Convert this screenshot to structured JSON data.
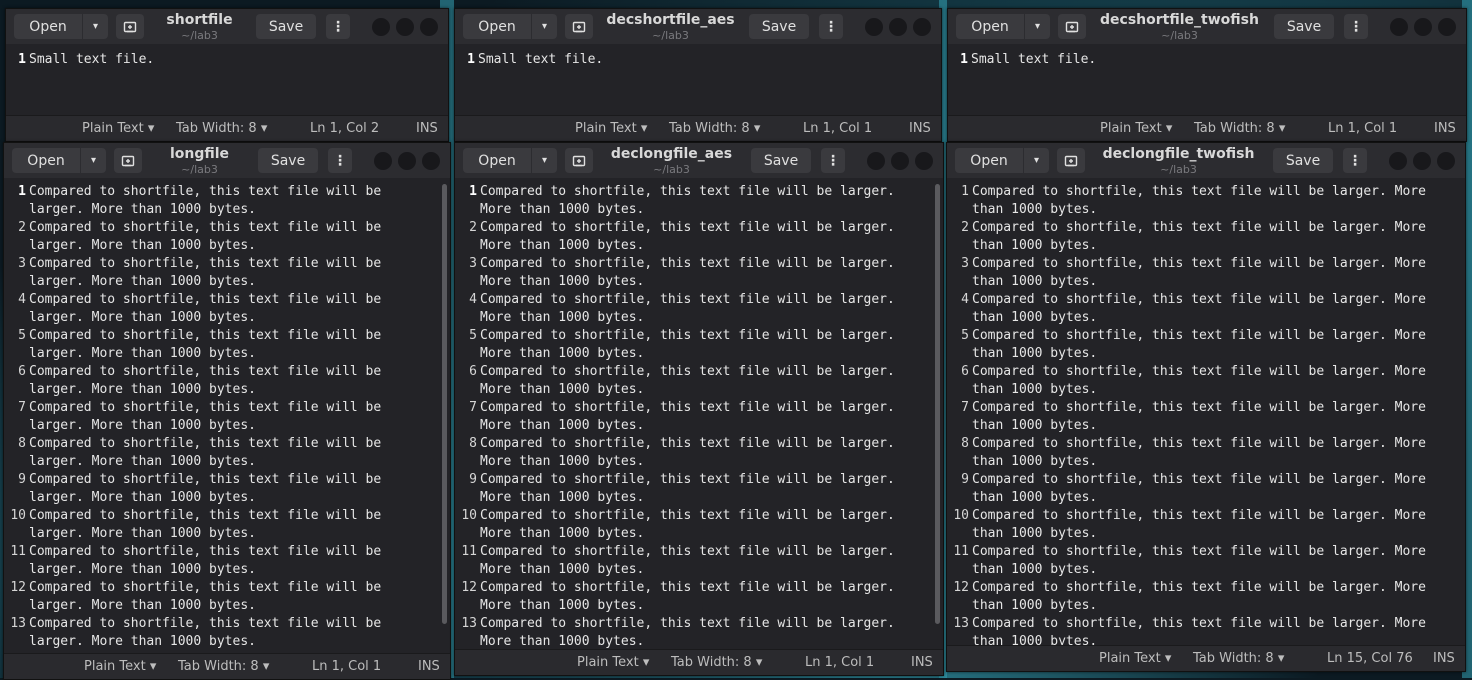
{
  "buttons": {
    "open": "Open",
    "save": "Save",
    "menu": "⋮",
    "dropdown": "▾"
  },
  "statusbar": {
    "language": "Plain Text ▾",
    "tab_width": "Tab Width: 8 ▾",
    "insert_mode": "INS"
  },
  "windows": [
    {
      "title": "shortfile",
      "subtitle": "~/lab3",
      "position_label": "Ln 1, Col 2",
      "lines": [
        {
          "num": "1",
          "text": "Small text file."
        }
      ]
    },
    {
      "title": "decshortfile_aes",
      "subtitle": "~/lab3",
      "position_label": "Ln 1, Col 1",
      "lines": [
        {
          "num": "1",
          "text": "Small text file."
        }
      ]
    },
    {
      "title": "decshortfile_twofish",
      "subtitle": "~/lab3",
      "position_label": "Ln 1, Col 1",
      "lines": [
        {
          "num": "1",
          "text": "Small text file."
        }
      ]
    },
    {
      "title": "longfile",
      "subtitle": "~/lab3",
      "position_label": "Ln 1, Col 1",
      "lines": [
        {
          "num": "1",
          "text": "Compared to shortfile, this text file will be"
        },
        {
          "num": "",
          "text": "larger. More than 1000 bytes."
        },
        {
          "num": "2",
          "text": "Compared to shortfile, this text file will be"
        },
        {
          "num": "",
          "text": "larger. More than 1000 bytes."
        },
        {
          "num": "3",
          "text": "Compared to shortfile, this text file will be"
        },
        {
          "num": "",
          "text": "larger. More than 1000 bytes."
        },
        {
          "num": "4",
          "text": "Compared to shortfile, this text file will be"
        },
        {
          "num": "",
          "text": "larger. More than 1000 bytes."
        },
        {
          "num": "5",
          "text": "Compared to shortfile, this text file will be"
        },
        {
          "num": "",
          "text": "larger. More than 1000 bytes."
        },
        {
          "num": "6",
          "text": "Compared to shortfile, this text file will be"
        },
        {
          "num": "",
          "text": "larger. More than 1000 bytes."
        },
        {
          "num": "7",
          "text": "Compared to shortfile, this text file will be"
        },
        {
          "num": "",
          "text": "larger. More than 1000 bytes."
        },
        {
          "num": "8",
          "text": "Compared to shortfile, this text file will be"
        },
        {
          "num": "",
          "text": "larger. More than 1000 bytes."
        },
        {
          "num": "9",
          "text": "Compared to shortfile, this text file will be"
        },
        {
          "num": "",
          "text": "larger. More than 1000 bytes."
        },
        {
          "num": "10",
          "text": "Compared to shortfile, this text file will be"
        },
        {
          "num": "",
          "text": "larger. More than 1000 bytes."
        },
        {
          "num": "11",
          "text": "Compared to shortfile, this text file will be"
        },
        {
          "num": "",
          "text": "larger. More than 1000 bytes."
        },
        {
          "num": "12",
          "text": "Compared to shortfile, this text file will be"
        },
        {
          "num": "",
          "text": "larger. More than 1000 bytes."
        },
        {
          "num": "13",
          "text": "Compared to shortfile, this text file will be"
        },
        {
          "num": "",
          "text": "larger. More than 1000 bytes."
        }
      ]
    },
    {
      "title": "declongfile_aes",
      "subtitle": "~/lab3",
      "position_label": "Ln 1, Col 1",
      "lines": [
        {
          "num": "1",
          "text": "Compared to shortfile, this text file will be larger."
        },
        {
          "num": "",
          "text": "More than 1000 bytes."
        },
        {
          "num": "2",
          "text": "Compared to shortfile, this text file will be larger."
        },
        {
          "num": "",
          "text": "More than 1000 bytes."
        },
        {
          "num": "3",
          "text": "Compared to shortfile, this text file will be larger."
        },
        {
          "num": "",
          "text": "More than 1000 bytes."
        },
        {
          "num": "4",
          "text": "Compared to shortfile, this text file will be larger."
        },
        {
          "num": "",
          "text": "More than 1000 bytes."
        },
        {
          "num": "5",
          "text": "Compared to shortfile, this text file will be larger."
        },
        {
          "num": "",
          "text": "More than 1000 bytes."
        },
        {
          "num": "6",
          "text": "Compared to shortfile, this text file will be larger."
        },
        {
          "num": "",
          "text": "More than 1000 bytes."
        },
        {
          "num": "7",
          "text": "Compared to shortfile, this text file will be larger."
        },
        {
          "num": "",
          "text": "More than 1000 bytes."
        },
        {
          "num": "8",
          "text": "Compared to shortfile, this text file will be larger."
        },
        {
          "num": "",
          "text": "More than 1000 bytes."
        },
        {
          "num": "9",
          "text": "Compared to shortfile, this text file will be larger."
        },
        {
          "num": "",
          "text": "More than 1000 bytes."
        },
        {
          "num": "10",
          "text": "Compared to shortfile, this text file will be larger."
        },
        {
          "num": "",
          "text": "More than 1000 bytes."
        },
        {
          "num": "11",
          "text": "Compared to shortfile, this text file will be larger."
        },
        {
          "num": "",
          "text": "More than 1000 bytes."
        },
        {
          "num": "12",
          "text": "Compared to shortfile, this text file will be larger."
        },
        {
          "num": "",
          "text": "More than 1000 bytes."
        },
        {
          "num": "13",
          "text": "Compared to shortfile, this text file will be larger."
        },
        {
          "num": "",
          "text": "More than 1000 bytes."
        }
      ]
    },
    {
      "title": "declongfile_twofish",
      "subtitle": "~/lab3",
      "position_label": "Ln 15, Col 76",
      "lines": [
        {
          "num": "1",
          "text": "Compared to shortfile, this text file will be larger. More"
        },
        {
          "num": "",
          "text": "than 1000 bytes."
        },
        {
          "num": "2",
          "text": "Compared to shortfile, this text file will be larger. More"
        },
        {
          "num": "",
          "text": "than 1000 bytes."
        },
        {
          "num": "3",
          "text": "Compared to shortfile, this text file will be larger. More"
        },
        {
          "num": "",
          "text": "than 1000 bytes."
        },
        {
          "num": "4",
          "text": "Compared to shortfile, this text file will be larger. More"
        },
        {
          "num": "",
          "text": "than 1000 bytes."
        },
        {
          "num": "5",
          "text": "Compared to shortfile, this text file will be larger. More"
        },
        {
          "num": "",
          "text": "than 1000 bytes."
        },
        {
          "num": "6",
          "text": "Compared to shortfile, this text file will be larger. More"
        },
        {
          "num": "",
          "text": "than 1000 bytes."
        },
        {
          "num": "7",
          "text": "Compared to shortfile, this text file will be larger. More"
        },
        {
          "num": "",
          "text": "than 1000 bytes."
        },
        {
          "num": "8",
          "text": "Compared to shortfile, this text file will be larger. More"
        },
        {
          "num": "",
          "text": "than 1000 bytes."
        },
        {
          "num": "9",
          "text": "Compared to shortfile, this text file will be larger. More"
        },
        {
          "num": "",
          "text": "than 1000 bytes."
        },
        {
          "num": "10",
          "text": "Compared to shortfile, this text file will be larger. More"
        },
        {
          "num": "",
          "text": "than 1000 bytes."
        },
        {
          "num": "11",
          "text": "Compared to shortfile, this text file will be larger. More"
        },
        {
          "num": "",
          "text": "than 1000 bytes."
        },
        {
          "num": "12",
          "text": "Compared to shortfile, this text file will be larger. More"
        },
        {
          "num": "",
          "text": "than 1000 bytes."
        },
        {
          "num": "13",
          "text": "Compared to shortfile, this text file will be larger. More"
        },
        {
          "num": "",
          "text": "than 1000 bytes."
        }
      ]
    }
  ]
}
